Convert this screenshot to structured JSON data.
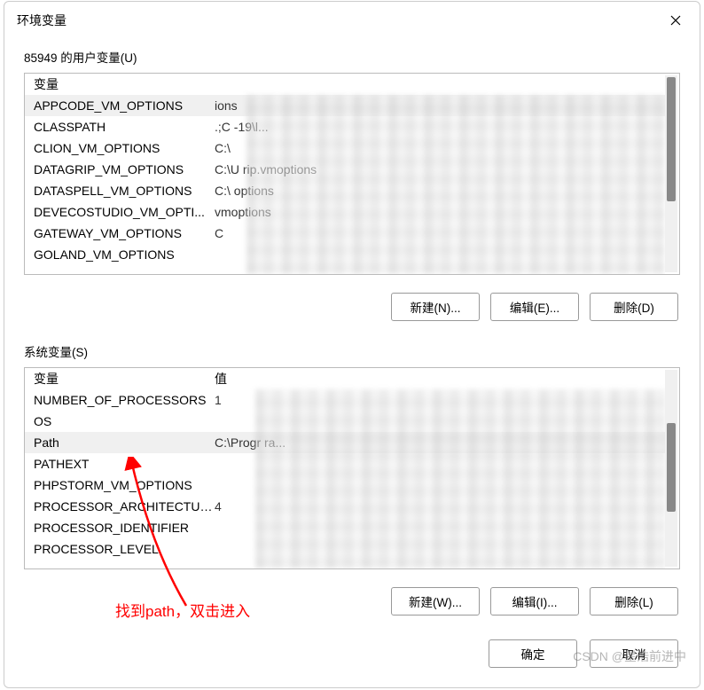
{
  "window": {
    "title": "环境变量"
  },
  "user_section": {
    "label": "85949 的用户变量(U)",
    "col_var": "变量",
    "vars": [
      {
        "name": "APPCODE_VM_OPTIONS",
        "value_hint": "                                                              ions"
      },
      {
        "name": "CLASSPATH",
        "value_hint": ".;C                                                                       -19\\l..."
      },
      {
        "name": "CLION_VM_OPTIONS",
        "value_hint": "C:\\"
      },
      {
        "name": "DATAGRIP_VM_OPTIONS",
        "value_hint": "C:\\U                                              rip.vmoptions"
      },
      {
        "name": "DATASPELL_VM_OPTIONS",
        "value_hint": "C:\\                                                       options"
      },
      {
        "name": "DEVECOSTUDIO_VM_OPTI...",
        "value_hint": "                                                        vmoptions"
      },
      {
        "name": "GATEWAY_VM_OPTIONS",
        "value_hint": "C"
      },
      {
        "name": "GOLAND_VM_OPTIONS",
        "value_hint": ""
      }
    ],
    "buttons": {
      "new": "新建(N)...",
      "edit": "编辑(E)...",
      "delete": "删除(D)"
    }
  },
  "system_section": {
    "label": "系统变量(S)",
    "col_var": "变量",
    "col_val": "值",
    "vars": [
      {
        "name": "NUMBER_OF_PROCESSORS",
        "value_hint": "1"
      },
      {
        "name": "OS",
        "value_hint": ""
      },
      {
        "name": "Path",
        "value_hint": "C:\\Progr                                                                       ra...",
        "selected": true
      },
      {
        "name": "PATHEXT",
        "value_hint": ""
      },
      {
        "name": "PHPSTORM_VM_OPTIONS",
        "value_hint": ""
      },
      {
        "name": "PROCESSOR_ARCHITECTURE",
        "value_hint": "          4"
      },
      {
        "name": "PROCESSOR_IDENTIFIER",
        "value_hint": ""
      },
      {
        "name": "PROCESSOR_LEVEL",
        "value_hint": ""
      }
    ],
    "buttons": {
      "new": "新建(W)...",
      "edit": "编辑(I)...",
      "delete": "删除(L)"
    }
  },
  "dialog_buttons": {
    "ok": "确定",
    "cancel": "取消"
  },
  "annotation": "找到path，双击进入",
  "watermark": "CSDN @星浩前进中"
}
